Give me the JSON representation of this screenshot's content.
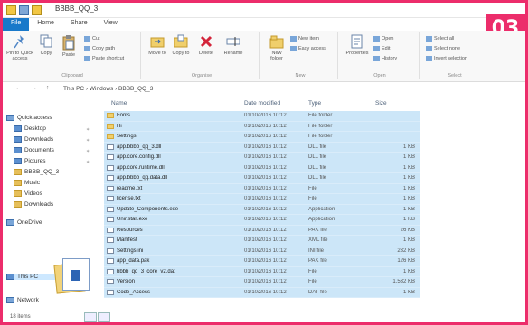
{
  "window": {
    "title": "BBBB_QQ_3"
  },
  "badge": "03",
  "tabs": [
    {
      "label": "File"
    },
    {
      "label": "Home"
    },
    {
      "label": "Share"
    },
    {
      "label": "View"
    }
  ],
  "ribbon": {
    "groups": [
      {
        "label": "Clipboard"
      },
      {
        "label": "Organise"
      },
      {
        "label": "New"
      },
      {
        "label": "Open"
      },
      {
        "label": "Select"
      }
    ],
    "buttons": {
      "pin": "Pin to Quick access",
      "copy": "Copy",
      "paste": "Paste",
      "cut": "Cut",
      "copy_path": "Copy path",
      "paste_shortcut": "Paste shortcut",
      "move_to": "Move to",
      "copy_to": "Copy to",
      "delete": "Delete",
      "rename": "Rename",
      "new_folder": "New folder",
      "new_item": "New item",
      "easy_access": "Easy access",
      "properties": "Properties",
      "open": "Open",
      "edit": "Edit",
      "history": "History",
      "select_all": "Select all",
      "select_none": "Select none",
      "invert_selection": "Invert selection"
    }
  },
  "address": {
    "nav": "← → ↑",
    "path": "This PC › Windows › BBBB_QQ_3"
  },
  "nav_pane": {
    "items": [
      {
        "label": "Quick access"
      },
      {
        "label": "Desktop"
      },
      {
        "label": "Downloads"
      },
      {
        "label": "Documents"
      },
      {
        "label": "Pictures"
      },
      {
        "label": "BBBB_QQ_3"
      },
      {
        "label": "Music"
      },
      {
        "label": "Videos"
      },
      {
        "label": "Downloads"
      },
      {
        "label": "OneDrive"
      },
      {
        "label": "This PC"
      },
      {
        "label": "Network"
      }
    ]
  },
  "columns": {
    "name": "Name",
    "date": "Date modified",
    "type": "Type",
    "size": "Size"
  },
  "files": [
    {
      "name": "Fonts",
      "date": "01/10/2016 10:12",
      "type": "File folder",
      "size": "",
      "icon": "folder"
    },
    {
      "name": "Hi",
      "date": "01/10/2016 10:12",
      "type": "File folder",
      "size": "",
      "icon": "folder"
    },
    {
      "name": "Settings",
      "date": "01/10/2016 10:12",
      "type": "File folder",
      "size": "",
      "icon": "folder"
    },
    {
      "name": "app.bbbb_qq_3.dll",
      "date": "01/10/2016 10:12",
      "type": "DLL file",
      "size": "1 KB",
      "icon": "doc"
    },
    {
      "name": "app.core.config.dll",
      "date": "01/10/2016 10:12",
      "type": "DLL file",
      "size": "1 KB",
      "icon": "doc"
    },
    {
      "name": "app.core.runtime.dll",
      "date": "01/10/2016 10:12",
      "type": "DLL file",
      "size": "1 KB",
      "icon": "doc"
    },
    {
      "name": "app.bbbb_qq.data.dll",
      "date": "01/10/2016 10:12",
      "type": "DLL file",
      "size": "1 KB",
      "icon": "doc"
    },
    {
      "name": "readme.txt",
      "date": "01/10/2016 10:12",
      "type": "File",
      "size": "1 KB",
      "icon": "doc"
    },
    {
      "name": "license.txt",
      "date": "01/10/2016 10:12",
      "type": "File",
      "size": "1 KB",
      "icon": "doc"
    },
    {
      "name": "Update_Components.exe",
      "date": "01/10/2016 10:12",
      "type": "Application",
      "size": "1 KB",
      "icon": "doc"
    },
    {
      "name": "Uninstall.exe",
      "date": "01/10/2016 10:12",
      "type": "Application",
      "size": "1 KB",
      "icon": "doc"
    },
    {
      "name": "Resources",
      "date": "01/10/2016 10:12",
      "type": "PAK file",
      "size": "26 KB",
      "icon": "doc"
    },
    {
      "name": "Manifest",
      "date": "01/10/2016 10:12",
      "type": "XML file",
      "size": "1 KB",
      "icon": "doc"
    },
    {
      "name": "Settings.ini",
      "date": "01/10/2016 10:12",
      "type": "INI file",
      "size": "232 KB",
      "icon": "doc"
    },
    {
      "name": "app_data.pak",
      "date": "01/10/2016 10:12",
      "type": "PAK file",
      "size": "126 KB",
      "icon": "doc"
    },
    {
      "name": "bbbb_qq_3_core_v2.dat",
      "date": "01/10/2016 10:12",
      "type": "File",
      "size": "1 KB",
      "icon": "doc"
    },
    {
      "name": "Version",
      "date": "01/10/2016 10:12",
      "type": "File",
      "size": "1,532 KB",
      "icon": "doc"
    },
    {
      "name": "Code_Access",
      "date": "01/10/2016 10:12",
      "type": "DAT file",
      "size": "1 KB",
      "icon": "doc"
    }
  ],
  "status": {
    "text": "18 items",
    "views": [
      "Details",
      "Large icons"
    ]
  }
}
